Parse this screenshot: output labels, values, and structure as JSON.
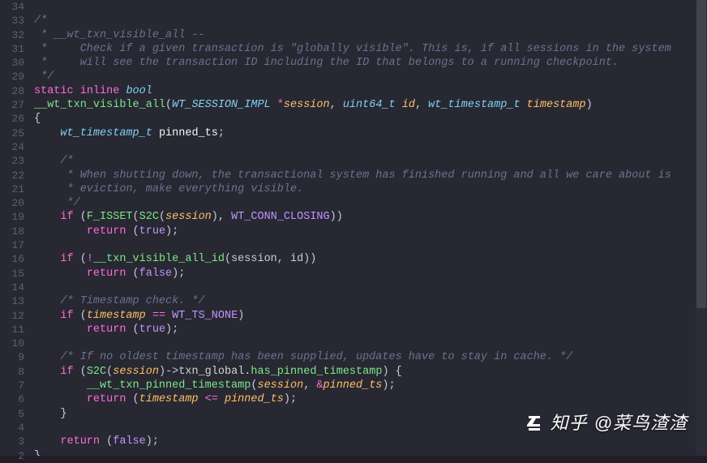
{
  "editor": {
    "line_start": 34,
    "line_end": 2,
    "lines": [
      {
        "n": 34,
        "kind": "plain",
        "tokens": []
      },
      {
        "n": 33,
        "kind": "comment",
        "text": "/*"
      },
      {
        "n": 32,
        "kind": "comment",
        "text": " * __wt_txn_visible_all --"
      },
      {
        "n": 31,
        "kind": "comment",
        "text": " *     Check if a given transaction is \"globally visible\". This is, if all sessions in the system"
      },
      {
        "n": 30,
        "kind": "comment",
        "text": " *     will see the transaction ID including the ID that belongs to a running checkpoint."
      },
      {
        "n": 29,
        "kind": "comment",
        "text": " */"
      },
      {
        "n": 28,
        "kind": "sig1"
      },
      {
        "n": 27,
        "kind": "sig2"
      },
      {
        "n": 26,
        "kind": "brace_open"
      },
      {
        "n": 25,
        "kind": "decl"
      },
      {
        "n": 24,
        "kind": "blank"
      },
      {
        "n": 23,
        "kind": "comment_indent",
        "text": "/*"
      },
      {
        "n": 22,
        "kind": "comment_indent",
        "text": " * When shutting down, the transactional system has finished running and all we care about is"
      },
      {
        "n": 21,
        "kind": "comment_indent",
        "text": " * eviction, make everything visible."
      },
      {
        "n": 20,
        "kind": "comment_indent",
        "text": " */"
      },
      {
        "n": 19,
        "kind": "if_isset"
      },
      {
        "n": 18,
        "kind": "return_true"
      },
      {
        "n": 17,
        "kind": "blank"
      },
      {
        "n": 16,
        "kind": "if_not_visible"
      },
      {
        "n": 15,
        "kind": "return_false"
      },
      {
        "n": 14,
        "kind": "blank"
      },
      {
        "n": 13,
        "kind": "comment_indent",
        "text": "/* Timestamp check. */"
      },
      {
        "n": 12,
        "kind": "if_ts_none"
      },
      {
        "n": 11,
        "kind": "return_true"
      },
      {
        "n": 10,
        "kind": "blank"
      },
      {
        "n": 9,
        "kind": "comment_indent",
        "text": "/* If no oldest timestamp has been supplied, updates have to stay in cache. */"
      },
      {
        "n": 8,
        "kind": "if_has_pinned"
      },
      {
        "n": 7,
        "kind": "call_pinned"
      },
      {
        "n": 6,
        "kind": "return_cmp"
      },
      {
        "n": 5,
        "kind": "close_brace_indent"
      },
      {
        "n": 4,
        "kind": "blank"
      },
      {
        "n": 3,
        "kind": "return_false_single"
      },
      {
        "n": 2,
        "kind": "brace_close"
      }
    ],
    "tokens": {
      "static": "static",
      "inline": "inline",
      "bool": "bool",
      "fnname": "__wt_txn_visible_all",
      "type_session": "WT_SESSION_IMPL",
      "param_session": "session",
      "type_u64": "uint64_t",
      "param_id": "id",
      "type_ts": "wt_timestamp_t",
      "param_ts": "timestamp",
      "decl_type": "wt_timestamp_t",
      "decl_name": "pinned_ts",
      "if": "if",
      "return": "return",
      "true": "true",
      "false": "false",
      "F_ISSET": "F_ISSET",
      "S2C": "S2C",
      "WT_CONN_CLOSING": "WT_CONN_CLOSING",
      "txn_visible_all_id": "__txn_visible_all_id",
      "WT_TS_NONE": "WT_TS_NONE",
      "txn_global": "txn_global",
      "has_pinned": "has_pinned_timestamp",
      "pinned_fn": "__wt_txn_pinned_timestamp",
      "pinned_ts": "pinned_ts"
    }
  },
  "watermark": {
    "prefix": "知乎",
    "user": "@菜鸟渣渣"
  }
}
